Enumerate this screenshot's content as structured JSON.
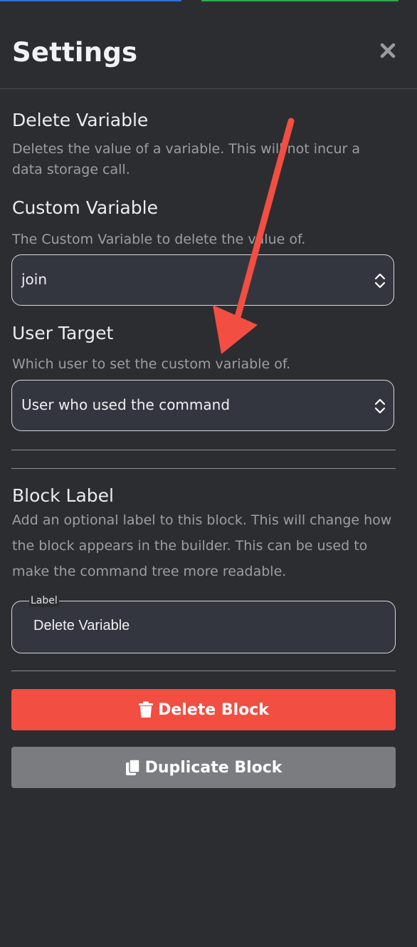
{
  "header": {
    "title": "Settings"
  },
  "block": {
    "name": "Delete Variable",
    "description": "Deletes the value of a variable. This will not incur a data storage call."
  },
  "custom_variable": {
    "title": "Custom Variable",
    "description": "The Custom Variable to delete the value of.",
    "selected": "join"
  },
  "user_target": {
    "title": "User Target",
    "description": "Which user to set the custom variable of.",
    "selected": "User who used the command"
  },
  "block_label": {
    "title": "Block Label",
    "description": "Add an optional label to this block. This will change how the block appears in the builder. This can be used to make the command tree more readable.",
    "field_label": "Label",
    "value": "Delete Variable"
  },
  "actions": {
    "delete_label": "Delete Block",
    "duplicate_label": "Duplicate Block"
  },
  "icons": {
    "close": "close-icon",
    "trash": "trash-icon",
    "copy": "copy-icon",
    "chevrons": "chevron-up-down-icon"
  },
  "colors": {
    "background": "#2c2d31",
    "delete": "#f24e42",
    "duplicate": "#7b7c7f",
    "annotation_arrow": "#f24e42"
  }
}
